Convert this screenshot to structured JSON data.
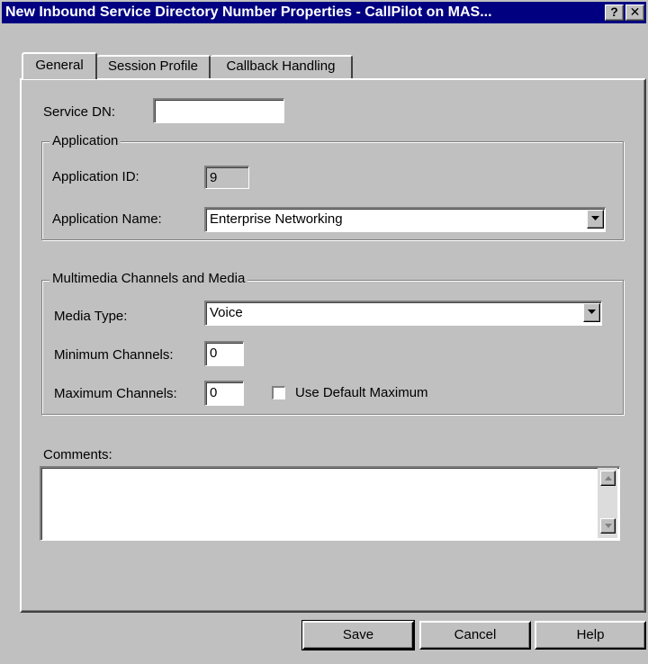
{
  "window": {
    "title": "New Inbound Service Directory Number Properties - CallPilot on MAS...",
    "help_button": "?",
    "close_button": "✕"
  },
  "tabs": [
    {
      "label": "General",
      "active": true
    },
    {
      "label": "Session Profile",
      "active": false
    },
    {
      "label": "Callback Handling",
      "active": false
    }
  ],
  "service_dn": {
    "label": "Service DN:",
    "value": ""
  },
  "application": {
    "group_title": "Application",
    "id_label": "Application ID:",
    "id_value": "9",
    "name_label": "Application Name:",
    "name_value": "Enterprise Networking"
  },
  "multimedia": {
    "group_title": "Multimedia Channels and Media",
    "media_type_label": "Media Type:",
    "media_type_value": "Voice",
    "min_label": "Minimum Channels:",
    "min_value": "0",
    "max_label": "Maximum Channels:",
    "max_value": "0",
    "use_default_label": "Use Default Maximum",
    "use_default_checked": false
  },
  "comments": {
    "label": "Comments:",
    "value": ""
  },
  "buttons": {
    "save": "Save",
    "cancel": "Cancel",
    "help": "Help"
  },
  "colors": {
    "titlebar": "#000080",
    "face": "#c0c0c0"
  }
}
